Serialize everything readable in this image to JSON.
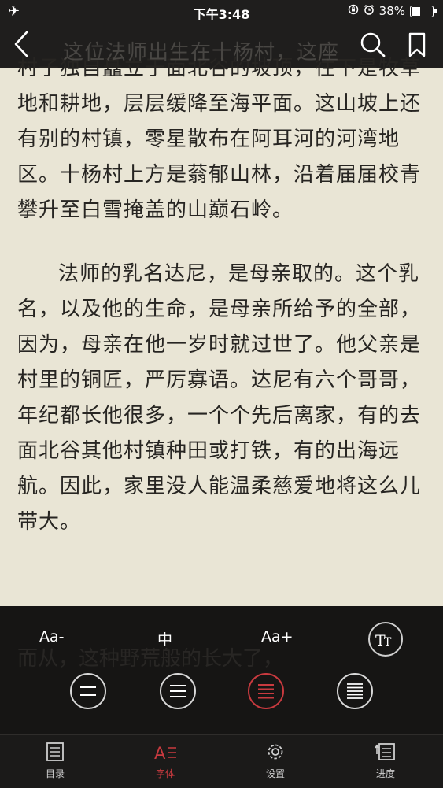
{
  "status_bar": {
    "time": "下午3:48",
    "battery": "38%",
    "battery_level": 0.38
  },
  "reader": {
    "hidden_first_line": "这位法师出生在十杨村，这座",
    "paragraphs": [
      "村子独自矗立于面北谷的坡顶，往下是牧草地和耕地，层层缓降至海平面。这山坡上还有别的村镇，零星散布在阿耳河的河湾地区。十杨村上方是蓊郁山林，沿着届届校青攀升至白雪掩盖的山巅石岭。",
      "法师的乳名达尼，是母亲取的。这个乳名，以及他的生命，是母亲所给予的全部，因为，母亲在他一岁时就过世了。他父亲是村里的铜匠，严厉寡语。达尼有六个哥哥，年纪都长他很多，一个个先后离家，有的去面北谷其他村镇种田或打铁，有的出海远航。因此，家里没人能温柔慈爱地将这么儿带大。"
    ],
    "text_behind_panel": "而从，这种野荒般的长大了，"
  },
  "font_panel": {
    "decrease_label": "Aa-",
    "size_label": "中",
    "increase_label": "Aa+"
  },
  "tabs": {
    "catalog": "目录",
    "font": "字体",
    "settings": "设置",
    "progress": "进度"
  },
  "colors": {
    "accent": "#c93a3f",
    "page_bg": "#e9e5d5",
    "panel_bg": "#161514"
  }
}
